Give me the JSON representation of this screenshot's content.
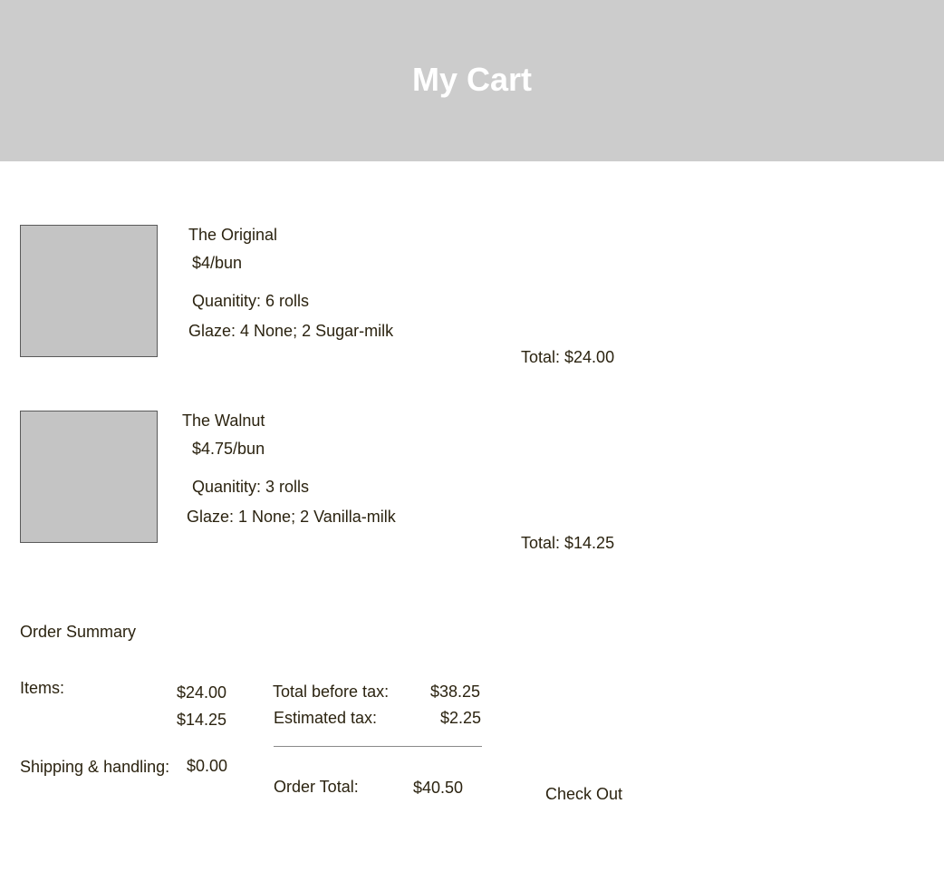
{
  "header": {
    "title": "My Cart"
  },
  "cart": {
    "items": [
      {
        "name": "The Original",
        "price": "$4/bun",
        "quantity": "Quanitity: 6 rolls",
        "glaze": "Glaze: 4 None; 2 Sugar-milk",
        "total": "Total: $24.00"
      },
      {
        "name": "The Walnut",
        "price": "$4.75/bun",
        "quantity": "Quanitity: 3 rolls",
        "glaze": "Glaze: 1 None; 2 Vanilla-milk",
        "total": "Total: $14.25"
      }
    ]
  },
  "summary": {
    "heading": "Order Summary",
    "items_label": "Items:",
    "item_amounts": [
      "$24.00",
      "$14.25"
    ],
    "shipping_label": "Shipping & handling:",
    "shipping_amount": "$0.00",
    "total_before_tax_label": "Total before tax:",
    "total_before_tax": "$38.25",
    "estimated_tax_label": "Estimated tax:",
    "estimated_tax": "$2.25",
    "order_total_label": "Order Total:",
    "order_total": "$40.50",
    "checkout_label": "Check Out"
  },
  "colors": {
    "header_bg": "#cccccc",
    "thumbnail_bg": "#c4c4c4",
    "text": "#2b2310"
  }
}
